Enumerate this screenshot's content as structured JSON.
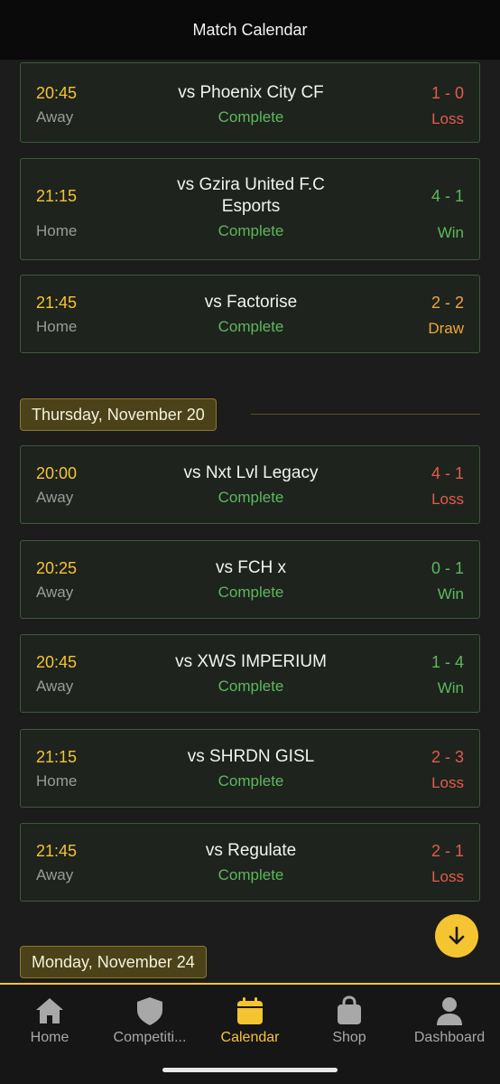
{
  "header": {
    "title": "Match Calendar"
  },
  "sections": {
    "prev": {
      "matches": [
        {
          "time": "20:45",
          "venue": "Away",
          "opponent": "vs Phoenix City CF",
          "status": "Complete",
          "score": "1 - 0",
          "result": "Loss"
        },
        {
          "time": "21:15",
          "venue": "Home",
          "opponent": "vs Gzira United F.C Esports",
          "status": "Complete",
          "score": "4 - 1",
          "result": "Win"
        },
        {
          "time": "21:45",
          "venue": "Home",
          "opponent": "vs Factorise",
          "status": "Complete",
          "score": "2 - 2",
          "result": "Draw"
        }
      ]
    },
    "nov20": {
      "date": "Thursday, November 20",
      "matches": [
        {
          "time": "20:00",
          "venue": "Away",
          "opponent": "vs Nxt Lvl Legacy",
          "status": "Complete",
          "score": "4 - 1",
          "result": "Loss"
        },
        {
          "time": "20:25",
          "venue": "Away",
          "opponent": "vs FCH x",
          "status": "Complete",
          "score": "0 - 1",
          "result": "Win"
        },
        {
          "time": "20:45",
          "venue": "Away",
          "opponent": "vs XWS IMPERIUM",
          "status": "Complete",
          "score": "1 - 4",
          "result": "Win"
        },
        {
          "time": "21:15",
          "venue": "Home",
          "opponent": "vs SHRDN GISL",
          "status": "Complete",
          "score": "2 - 3",
          "result": "Loss"
        },
        {
          "time": "21:45",
          "venue": "Away",
          "opponent": "vs Regulate",
          "status": "Complete",
          "score": "2 - 1",
          "result": "Loss"
        }
      ]
    },
    "nov24": {
      "date": "Monday, November 24"
    }
  },
  "tabs": [
    {
      "label": "Home",
      "icon": "home-icon"
    },
    {
      "label": "Competiti...",
      "icon": "shield-icon"
    },
    {
      "label": "Calendar",
      "icon": "calendar-icon",
      "active": true
    },
    {
      "label": "Shop",
      "icon": "shopping-bag-icon"
    },
    {
      "label": "Dashboard",
      "icon": "user-icon"
    }
  ],
  "colors": {
    "accent": "#f5c431",
    "win": "#5cb85c",
    "loss": "#e55b4b",
    "draw": "#f0a63b"
  }
}
